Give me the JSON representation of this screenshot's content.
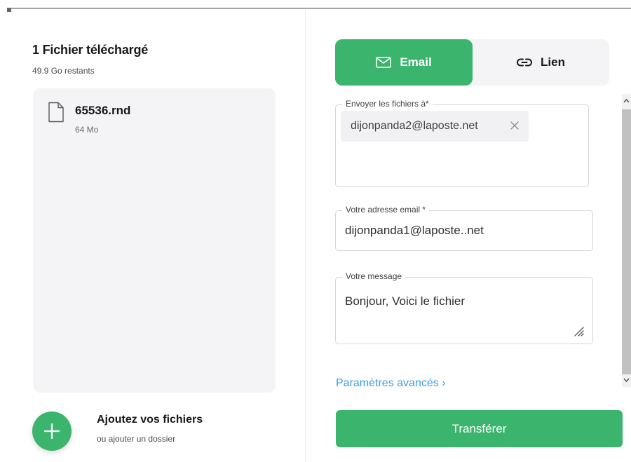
{
  "upload": {
    "title": "1 Fichier téléchargé",
    "remaining": "49.9 Go restants"
  },
  "files": [
    {
      "name": "65536.rnd",
      "size": "64 Mo",
      "icon": "file-icon"
    }
  ],
  "add": {
    "title": "Ajoutez vos fichiers",
    "subtitle": "ou ajouter un dossier",
    "icon": "plus-icon"
  },
  "tabs": {
    "email": {
      "label": "Email",
      "icon": "envelope-icon"
    },
    "link": {
      "label": "Lien",
      "icon": "link-icon"
    }
  },
  "form": {
    "recipients_label": "Envoyer les fichiers à*",
    "recipients": [
      "dijonpanda2@laposte.net"
    ],
    "sender_label": "Votre adresse email *",
    "sender_value": "dijonpanda1@laposte..net",
    "message_label": "Votre message",
    "message_value": "Bonjour, Voici le fichier",
    "advanced_label": "Paramètres avancés"
  },
  "transfer_label": "Transférer",
  "colors": {
    "accent": "#3bb46e",
    "panel": "#f4f4f6",
    "link": "#3b9ee8"
  }
}
